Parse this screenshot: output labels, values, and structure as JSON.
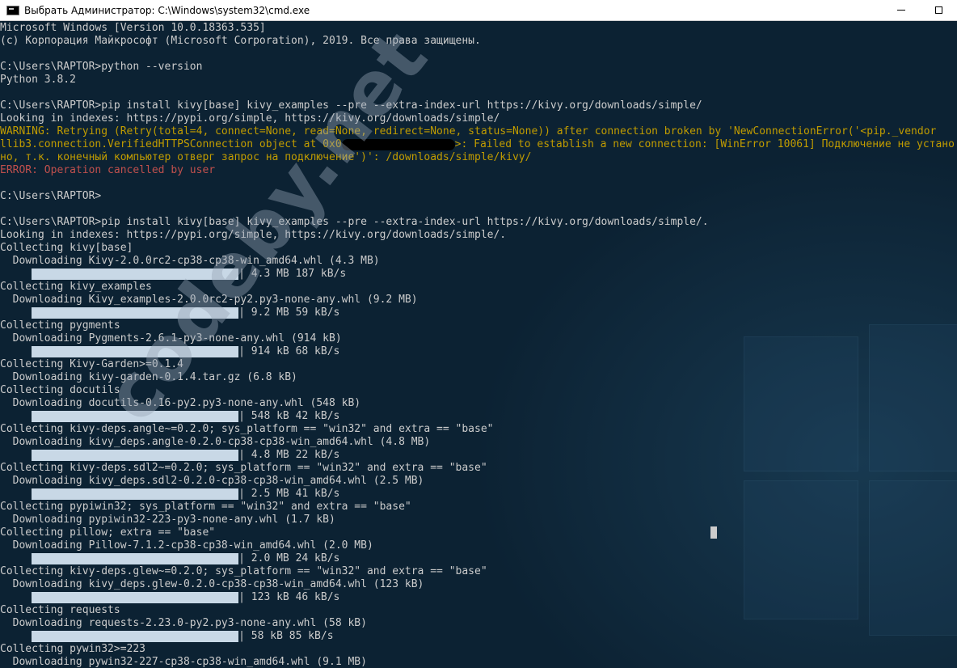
{
  "window": {
    "title": "Выбрать Администратор: C:\\Windows\\system32\\cmd.exe",
    "icon": "cmd-icon",
    "minimize_icon": "minimize-icon",
    "maximize_icon": "maximize-icon"
  },
  "watermark": "codeby.net",
  "colors": {
    "background": "#0c2233",
    "text": "#cccccc",
    "warning": "#c19c00",
    "error": "#c0504d",
    "progress": "#c8d8e6"
  },
  "lines": [
    {
      "type": "text",
      "text": "Microsoft Windows [Version 10.0.18363.535]"
    },
    {
      "type": "text",
      "text": "(c) Корпорация Майкрософт (Microsoft Corporation), 2019. Все права защищены."
    },
    {
      "type": "text",
      "text": ""
    },
    {
      "type": "text",
      "text": "C:\\Users\\RAPTOR>python --version"
    },
    {
      "type": "text",
      "text": "Python 3.8.2"
    },
    {
      "type": "text",
      "text": ""
    },
    {
      "type": "text",
      "text": "C:\\Users\\RAPTOR>pip install kivy[base] kivy_examples --pre --extra-index-url https://kivy.org/downloads/simple/"
    },
    {
      "type": "text",
      "text": "Looking in indexes: https://pypi.org/simple, https://kivy.org/downloads/simple/"
    },
    {
      "type": "warn",
      "text": "WARNING: Retrying (Retry(total=4, connect=None, read=None, redirect=None, status=None)) after connection broken by 'NewConnectionError('<pip._vendor"
    },
    {
      "type": "warn-redact",
      "before": "llib3.connection.VerifiedHTTPSConnection object at 0x0",
      "after": ">: Failed to establish a new connection: [WinError 10061] Подключение не устано"
    },
    {
      "type": "warn",
      "text": "но, т.к. конечный компьютер отверг запрос на подключение')': /downloads/simple/kivy/"
    },
    {
      "type": "err",
      "text": "ERROR: Operation cancelled by user"
    },
    {
      "type": "text",
      "text": ""
    },
    {
      "type": "text",
      "text": "C:\\Users\\RAPTOR>"
    },
    {
      "type": "text",
      "text": ""
    },
    {
      "type": "text",
      "text": "C:\\Users\\RAPTOR>pip install kivy[base] kivy_examples --pre --extra-index-url https://kivy.org/downloads/simple/."
    },
    {
      "type": "text",
      "text": "Looking in indexes: https://pypi.org/simple, https://kivy.org/downloads/simple/."
    },
    {
      "type": "text",
      "text": "Collecting kivy[base]"
    },
    {
      "type": "text",
      "text": "  Downloading Kivy-2.0.0rc2-cp38-cp38-win_amd64.whl (4.3 MB)"
    },
    {
      "type": "progress",
      "text": "| 4.3 MB 187 kB/s",
      "progress": 1.0
    },
    {
      "type": "text",
      "text": "Collecting kivy_examples"
    },
    {
      "type": "text",
      "text": "  Downloading Kivy_examples-2.0.0rc2-py2.py3-none-any.whl (9.2 MB)"
    },
    {
      "type": "progress",
      "text": "| 9.2 MB 59 kB/s",
      "progress": 1.0
    },
    {
      "type": "text",
      "text": "Collecting pygments"
    },
    {
      "type": "text",
      "text": "  Downloading Pygments-2.6.1-py3-none-any.whl (914 kB)"
    },
    {
      "type": "progress",
      "text": "| 914 kB 68 kB/s",
      "progress": 1.0
    },
    {
      "type": "text",
      "text": "Collecting Kivy-Garden>=0.1.4"
    },
    {
      "type": "text",
      "text": "  Downloading kivy-garden-0.1.4.tar.gz (6.8 kB)"
    },
    {
      "type": "text",
      "text": "Collecting docutils"
    },
    {
      "type": "text",
      "text": "  Downloading docutils-0.16-py2.py3-none-any.whl (548 kB)"
    },
    {
      "type": "progress",
      "text": "| 548 kB 42 kB/s",
      "progress": 1.0
    },
    {
      "type": "text",
      "text": "Collecting kivy-deps.angle~=0.2.0; sys_platform == \"win32\" and extra == \"base\""
    },
    {
      "type": "text",
      "text": "  Downloading kivy_deps.angle-0.2.0-cp38-cp38-win_amd64.whl (4.8 MB)"
    },
    {
      "type": "progress",
      "text": "| 4.8 MB 22 kB/s",
      "progress": 1.0
    },
    {
      "type": "text",
      "text": "Collecting kivy-deps.sdl2~=0.2.0; sys_platform == \"win32\" and extra == \"base\""
    },
    {
      "type": "text",
      "text": "  Downloading kivy_deps.sdl2-0.2.0-cp38-cp38-win_amd64.whl (2.5 MB)"
    },
    {
      "type": "progress",
      "text": "| 2.5 MB 41 kB/s",
      "progress": 1.0
    },
    {
      "type": "text",
      "text": "Collecting pypiwin32; sys_platform == \"win32\" and extra == \"base\""
    },
    {
      "type": "text",
      "text": "  Downloading pypiwin32-223-py3-none-any.whl (1.7 kB)"
    },
    {
      "type": "text",
      "text": "Collecting pillow; extra == \"base\""
    },
    {
      "type": "text",
      "text": "  Downloading Pillow-7.1.2-cp38-cp38-win_amd64.whl (2.0 MB)"
    },
    {
      "type": "progress",
      "text": "| 2.0 MB 24 kB/s",
      "progress": 1.0
    },
    {
      "type": "text",
      "text": "Collecting kivy-deps.glew~=0.2.0; sys_platform == \"win32\" and extra == \"base\""
    },
    {
      "type": "text",
      "text": "  Downloading kivy_deps.glew-0.2.0-cp38-cp38-win_amd64.whl (123 kB)"
    },
    {
      "type": "progress",
      "text": "| 123 kB 46 kB/s",
      "progress": 1.0
    },
    {
      "type": "text",
      "text": "Collecting requests"
    },
    {
      "type": "text",
      "text": "  Downloading requests-2.23.0-py2.py3-none-any.whl (58 kB)"
    },
    {
      "type": "progress",
      "text": "| 58 kB 85 kB/s",
      "progress": 1.0
    },
    {
      "type": "text",
      "text": "Collecting pywin32>=223"
    },
    {
      "type": "text",
      "text": "  Downloading pywin32-227-cp38-cp38-win_amd64.whl (9.1 MB)"
    }
  ]
}
